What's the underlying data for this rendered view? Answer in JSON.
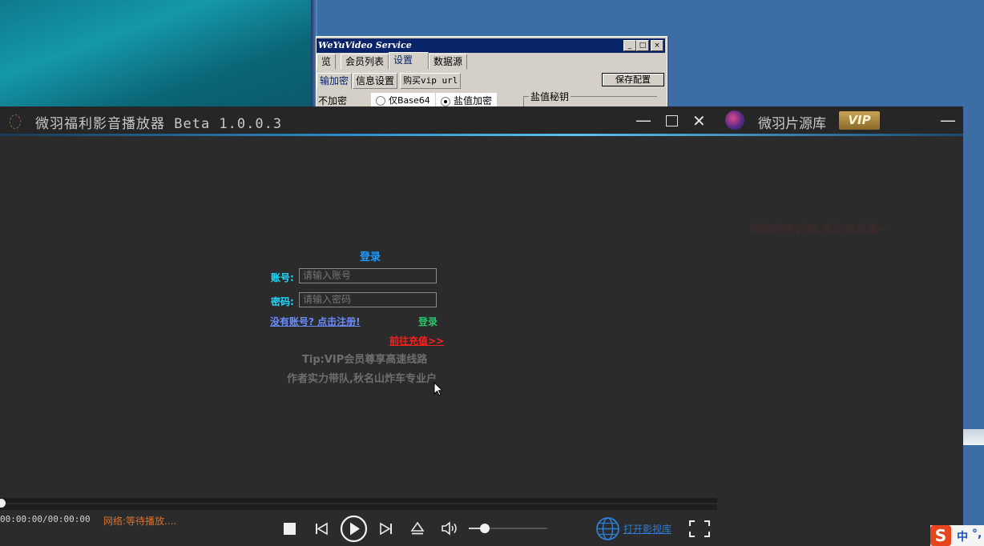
{
  "service_window": {
    "title": "WeYuVideo Service",
    "tabs": [
      "览",
      "会员列表",
      "设置",
      "数据源"
    ],
    "subtabs": [
      "输加密",
      "信息设置",
      "购买vip url"
    ],
    "save_label": "保存配置",
    "encryption_options": [
      "不加密",
      "仅Base64",
      "盐值加密"
    ],
    "selected_option": "盐值加密",
    "salt_group_label": "盐值秘钥",
    "minimize": "_",
    "maximize": "□",
    "close": "×"
  },
  "player": {
    "title": "微羽福利影音播放器  Beta 1.0.0.3",
    "minimize_glyph": "—",
    "maximize_glyph": "□",
    "close_glyph": "✕"
  },
  "library_panel": {
    "title": "微羽片源库",
    "vip_badge": "VIP",
    "minimize_glyph": "—",
    "message": "悄悄的告诉你,会员有彩蛋~"
  },
  "login": {
    "heading": "登录",
    "account_label": "账号:",
    "account_placeholder": "请输入账号",
    "password_label": "密码:",
    "password_placeholder": "请输入密码",
    "register_link": "没有账号? 点击注册!",
    "login_button": "登录",
    "recharge_link": "前往充值>>",
    "tip1": "Tip:VIP会员尊享高速线路",
    "tip2": "作者实力带队,秋名山炸车专业户"
  },
  "controls": {
    "time": "00:00:00/00:00:00",
    "network_status": "网络:等待播放....",
    "open_library": "打开影视库",
    "volume_level": 0.2,
    "progress": 0
  },
  "taskbar": {
    "ime_label": "中"
  },
  "colors": {
    "accent_blue": "#1e9bff",
    "cyan_label": "#20d8ff",
    "recharge_red": "#ff1e1e",
    "login_green": "#27c46a",
    "network_orange": "#d8722a"
  }
}
